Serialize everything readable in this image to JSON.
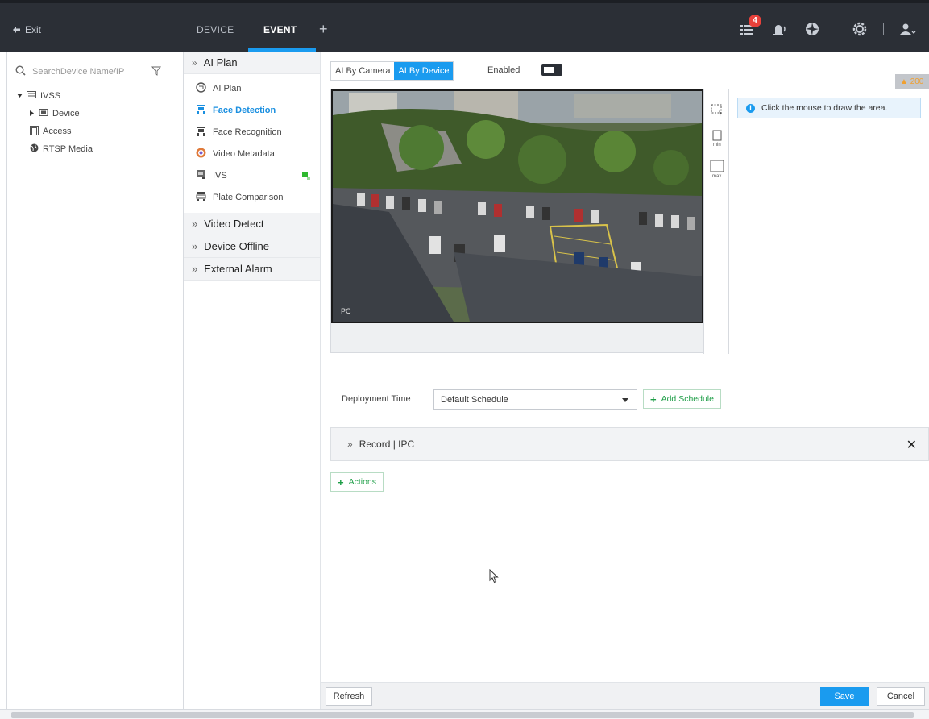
{
  "topbar": {
    "exit_label": "Exit",
    "tabs": [
      {
        "label": "DEVICE",
        "active": false
      },
      {
        "label": "EVENT",
        "active": true
      }
    ],
    "add_tab": "+",
    "alarm_count": "4",
    "icons": [
      "event-list-icon",
      "alarm-icon",
      "aperture-icon",
      "settings-icon",
      "user-icon"
    ]
  },
  "left": {
    "search_placeholder": "SearchDevice Name/IP",
    "tree": [
      {
        "label": "IVSS",
        "icon": "server-icon"
      },
      {
        "label": "Device",
        "icon": "device-icon"
      },
      {
        "label": "Access",
        "icon": "access-icon"
      },
      {
        "label": "RTSP Media",
        "icon": "globe-icon"
      }
    ]
  },
  "middle": {
    "ai_plan_header": "AI Plan",
    "plan_items": [
      {
        "label": "AI Plan",
        "active": false
      },
      {
        "label": "Face Detection",
        "active": true
      },
      {
        "label": "Face Recognition",
        "active": false
      },
      {
        "label": "Video Metadata",
        "active": false
      },
      {
        "label": "IVS",
        "active": false
      },
      {
        "label": "Plate Comparison",
        "active": false
      }
    ],
    "sections": [
      "Video Detect",
      "Device Offline",
      "External Alarm"
    ]
  },
  "content": {
    "seg_ai_by_camera": "AI By Camera",
    "seg_ai_by_device": "AI By Device",
    "enabled_label": "Enabled",
    "warning_text": "200",
    "video_label": "PC",
    "hint": "Click the mouse to draw the area.",
    "deployment_label": "Deployment Time",
    "schedule_value": "Default Schedule",
    "add_schedule": "Add Schedule",
    "record_label": "Record | IPC",
    "actions_label": "Actions"
  },
  "footer": {
    "refresh": "Refresh",
    "save": "Save",
    "cancel": "Cancel"
  },
  "colors": {
    "accent": "#1a9bef",
    "topbar": "#2b2f36",
    "green_action": "#1e9e47",
    "badge": "#e8413b"
  }
}
